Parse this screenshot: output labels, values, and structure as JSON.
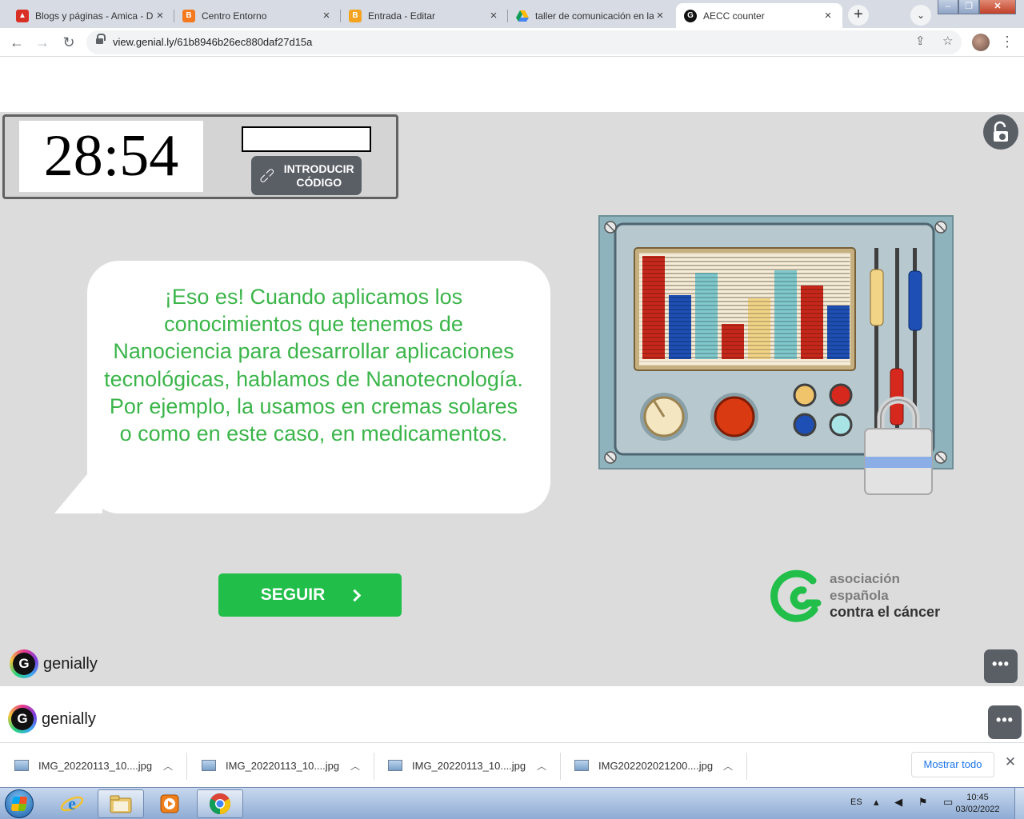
{
  "browser": {
    "tabs": [
      {
        "title": "Blogs y páginas - Amica - D",
        "icon": "blogger-admin-icon",
        "color": "#d93025"
      },
      {
        "title": "Centro Entorno",
        "icon": "blogger-icon",
        "color": "#f4791f"
      },
      {
        "title": "Entrada - Editar",
        "icon": "blogger-icon",
        "color": "#f4a31f"
      },
      {
        "title": "taller de comunicación en la",
        "icon": "google-drive-icon",
        "color": "#1fa463"
      },
      {
        "title": "AECC counter",
        "icon": "genially-icon",
        "color": "#111111"
      }
    ],
    "active_tab": 4,
    "url": "view.genial.ly/61b8946b26ec880daf27d15a"
  },
  "genially": {
    "timer": "28:54",
    "code_input": {
      "value": "",
      "placeholder": ""
    },
    "code_button": "INTRODUCIR CÓDIGO",
    "message": "¡Eso es! Cuando aplicamos los conocimientos que tenemos de Nanociencia para desarrollar aplicaciones tecnológicas, hablamos de Nanotecnología. Por ejemplo, la usamos en cremas solares o como en este caso, en medicamentos.",
    "next_button": "SEGUIR",
    "aecc": {
      "line1": "asociación",
      "line2": "española",
      "line3": "contra el cáncer"
    },
    "brand": "genially",
    "colors": {
      "accent_green": "#21bf4a",
      "message_green": "#3bb54a",
      "button_gray": "#5a5f66"
    }
  },
  "page": {
    "brand": "genially"
  },
  "downloads": {
    "items": [
      {
        "name": "IMG_20220113_10....jpg"
      },
      {
        "name": "IMG_20220113_10....jpg"
      },
      {
        "name": "IMG_20220113_10....jpg"
      },
      {
        "name": "IMG202202021200....jpg"
      }
    ],
    "show_all": "Mostrar todo"
  },
  "taskbar": {
    "language": "ES",
    "time": "10:45",
    "date": "03/02/2022"
  }
}
